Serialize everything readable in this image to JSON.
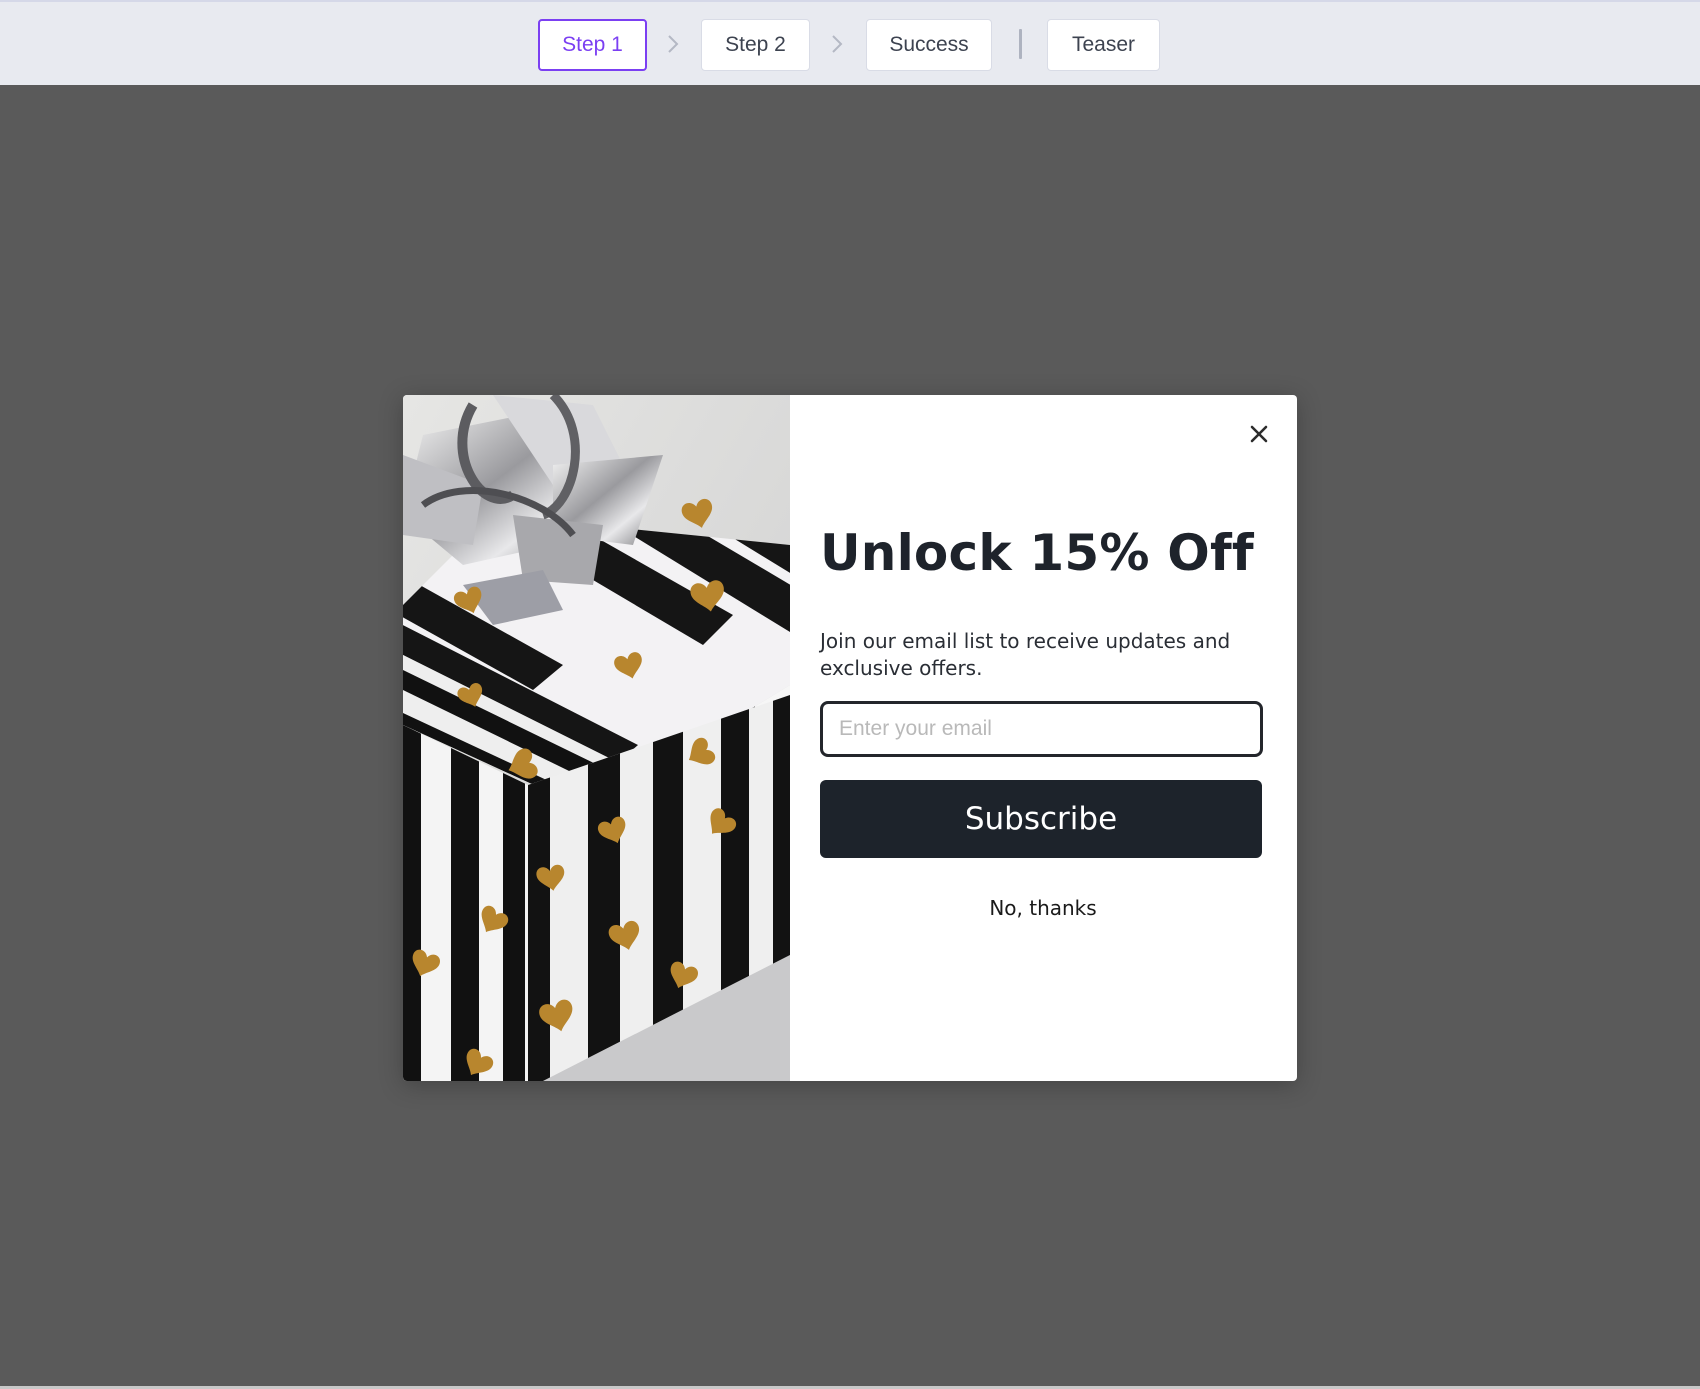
{
  "topbar": {
    "steps": [
      {
        "label": "Step 1",
        "active": true
      },
      {
        "label": "Step 2",
        "active": false
      },
      {
        "label": "Success",
        "active": false
      },
      {
        "label": "Teaser",
        "active": false
      }
    ],
    "separator_icon": "chevron-right-icon",
    "accent_color": "#7b3ff2"
  },
  "popup": {
    "image_alt": "Black and white striped gift box with gold hearts and a silver bow",
    "close_icon": "close-icon",
    "headline": "Unlock 15% Off",
    "subtext": "Join our email list to receive updates and exclusive offers.",
    "email": {
      "value": "",
      "placeholder": "Enter your email"
    },
    "subscribe_label": "Subscribe",
    "decline_label": "No, thanks",
    "button_color": "#1d232b"
  }
}
